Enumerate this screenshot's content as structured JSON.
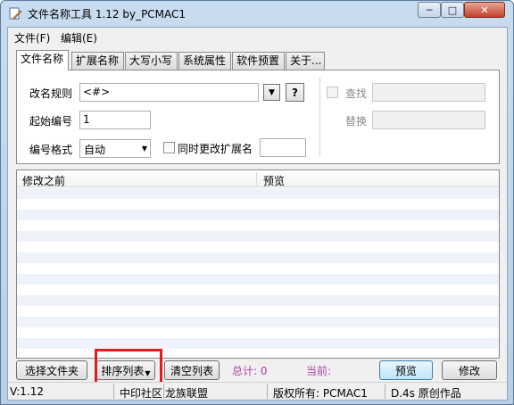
{
  "window": {
    "title": "文件名称工具 1.12  by_PCMAC1",
    "minimize_glyph": "─",
    "maximize_glyph": "□",
    "close_glyph": "✕",
    "app_icon": "pencil-file-icon"
  },
  "menu": [
    {
      "label": "文件(F)"
    },
    {
      "label": "编辑(E)"
    }
  ],
  "tabs": [
    {
      "label": "文件名称",
      "active": true
    },
    {
      "label": "扩展名称"
    },
    {
      "label": "大写小写"
    },
    {
      "label": "系统属性"
    },
    {
      "label": "软件预置"
    },
    {
      "label": "关于..."
    }
  ],
  "form": {
    "rule_label": "改名规则",
    "rule_value": "<#>",
    "help_label": "?",
    "start_label": "起始编号",
    "start_value": "1",
    "format_label": "编号格式",
    "format_value": "自动",
    "change_ext_label": "同时更改扩展名",
    "find_label": "查找",
    "replace_label": "替换"
  },
  "list": {
    "col_before": "修改之前",
    "col_preview": "预览",
    "rows": []
  },
  "buttons": {
    "choose_folder": "选择文件夹",
    "sort_list": "排序列表",
    "clear_list": "清空列表",
    "preview": "预览",
    "modify": "修改"
  },
  "info": {
    "total": "总计: 0",
    "current": "当前:"
  },
  "status": {
    "version": "V:1.12",
    "community": "中印社区",
    "alliance": "龙族联盟",
    "copyright": "版权所有: PCMAC1",
    "original": "D.4s 原创作品"
  },
  "colors": {
    "highlight_box": "#e11b1b",
    "info_text": "#b03fa8",
    "list_alt_row": "#eef3fb"
  }
}
